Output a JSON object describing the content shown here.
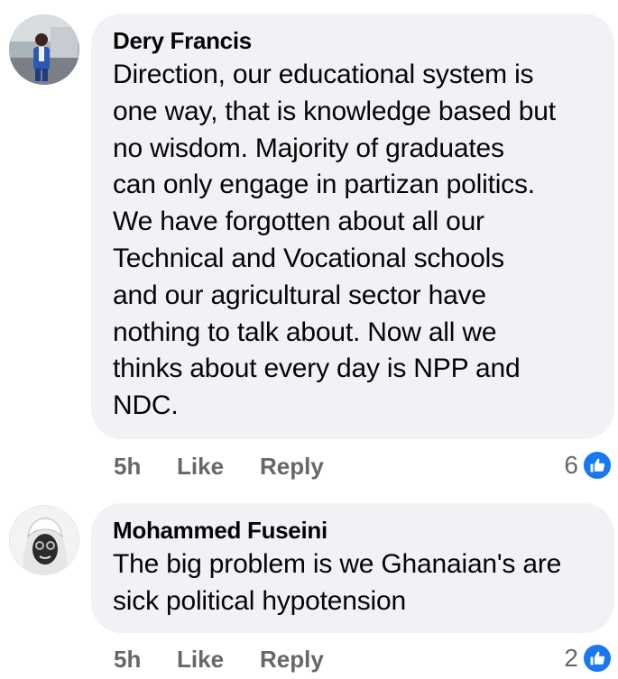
{
  "colors": {
    "bubble": "#f0f2f5",
    "meta": "#65676b",
    "like_blue": "#1877f2"
  },
  "comments": [
    {
      "author": "Dery Francis",
      "text": "Direction, our educational system is\none way, that is knowledge based but\nno wisdom. Majority of graduates\ncan only engage in partizan politics.\nWe have forgotten about all our\nTechnical and Vocational schools\nand our agricultural sector have\nnothing to talk about. Now all we\nthinks about every  day is NPP and\nNDC.",
      "time": "5h",
      "like_label": "Like",
      "reply_label": "Reply",
      "reaction_count": "6",
      "reaction_icon": "thumbs-up-icon"
    },
    {
      "author": "Mohammed Fuseini",
      "text": "The big problem is we Ghanaian's are\nsick political hypotension",
      "time": "5h",
      "like_label": "Like",
      "reply_label": "Reply",
      "reaction_count": "2",
      "reaction_icon": "thumbs-up-icon"
    }
  ]
}
